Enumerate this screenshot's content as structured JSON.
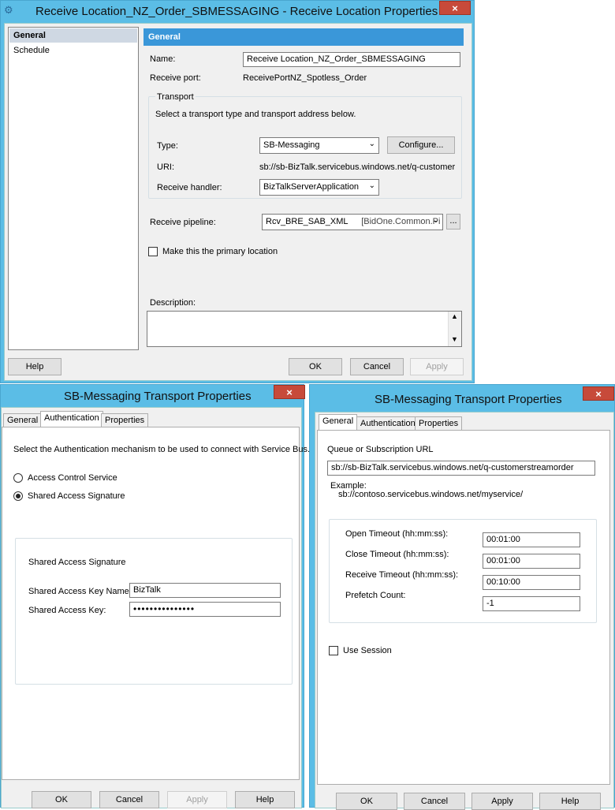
{
  "win1": {
    "title": "Receive Location_NZ_Order_SBMESSAGING - Receive Location Properties",
    "close": "×",
    "nav": [
      "General",
      "Schedule"
    ],
    "header": "General",
    "name_label": "Name:",
    "name_value": "Receive Location_NZ_Order_SBMESSAGING",
    "port_label": "Receive port:",
    "port_value": "ReceivePortNZ_Spotless_Order",
    "transport_label": "Transport",
    "transport_hint": "Select a transport type and transport address below.",
    "type_label": "Type:",
    "type_value": "SB-Messaging",
    "configure": "Configure...",
    "uri_label": "URI:",
    "uri_value": "sb://sb-BizTalk.servicebus.windows.net/q-customerstrea",
    "handler_label": "Receive handler:",
    "handler_value": "BizTalkServerApplication",
    "pipeline_label": "Receive pipeline:",
    "pipeline_value": "Rcv_BRE_SAB_XML",
    "pipeline_assembly": "[BidOne.Common.Pi",
    "browse": "...",
    "primary_label": "Make this the primary location",
    "desc_label": "Description:",
    "help": "Help",
    "ok": "OK",
    "cancel": "Cancel",
    "apply": "Apply"
  },
  "win2": {
    "title": "SB-Messaging Transport Properties",
    "close": "×",
    "tabs": [
      "General",
      "Authentication",
      "Properties"
    ],
    "intro": "Select the Authentication mechanism to be used to connect with Service Bus.",
    "option1": "Access Control Service",
    "option2": "Shared Access Signature",
    "group_title": "Shared Access Signature",
    "key_name_label": "Shared Access Key Name:",
    "key_name_value": "BizTalk",
    "key_label": "Shared Access Key:",
    "key_value": "•••••••••••••••",
    "ok": "OK",
    "cancel": "Cancel",
    "apply": "Apply",
    "help": "Help"
  },
  "win3": {
    "title": "SB-Messaging Transport Properties",
    "close": "×",
    "tabs": [
      "General",
      "Authentication",
      "Properties"
    ],
    "url_label": "Queue or Subscription URL",
    "url_value": "sb://sb-BizTalk.servicebus.windows.net/q-customerstreamorder",
    "example_label": "Example:",
    "example_value": "sb://contoso.servicebus.windows.net/myservice/",
    "open_label": "Open Timeout (hh:mm:ss):",
    "open_value": "00:01:00",
    "close_label": "Close Timeout (hh:mm:ss):",
    "close_value": "00:01:00",
    "receive_label": "Receive Timeout (hh:mm:ss):",
    "receive_value": "00:10:00",
    "prefetch_label": "Prefetch Count:",
    "prefetch_value": "-1",
    "session_label": "Use Session",
    "ok": "OK",
    "cancel": "Cancel",
    "apply": "Apply",
    "help": "Help"
  }
}
